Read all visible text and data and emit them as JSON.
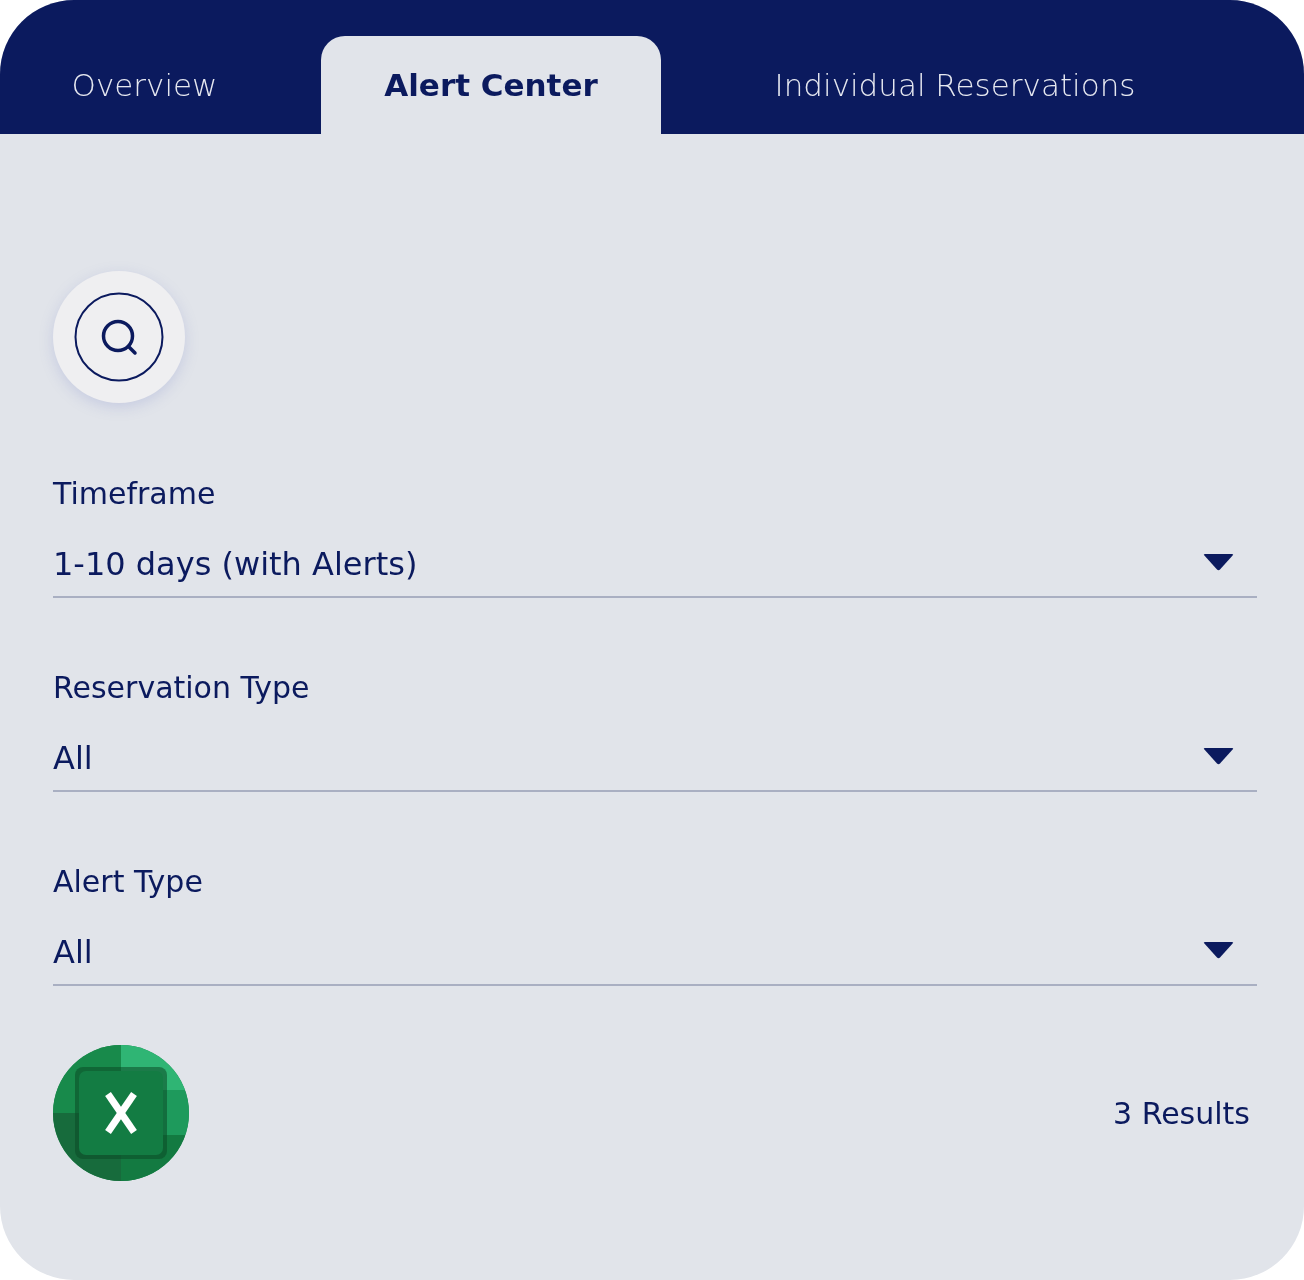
{
  "tabs": [
    {
      "label": "Overview",
      "selected": false
    },
    {
      "label": "Alert Center",
      "selected": true
    },
    {
      "label": "Individual Reservations",
      "selected": false
    }
  ],
  "filters": [
    {
      "label": "Timeframe",
      "value": "1-10 days (with Alerts)"
    },
    {
      "label": "Reservation Type",
      "value": "All"
    },
    {
      "label": "Alert Type",
      "value": "All"
    }
  ],
  "results_count": "3 Results"
}
